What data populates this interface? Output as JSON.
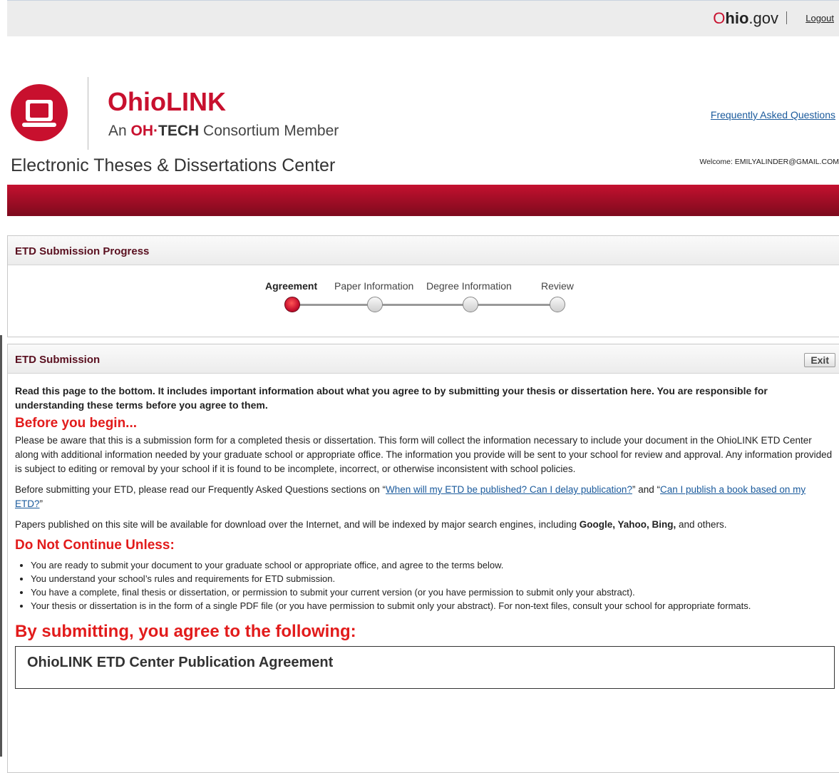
{
  "header": {
    "ohio_o": "O",
    "ohio_hio": "hio",
    "ohio_gov": ".gov",
    "logout": "Logout"
  },
  "brand": {
    "name": "OhioLINK",
    "sub_an": "An ",
    "sub_oh": "OH",
    "sub_dot": "·",
    "sub_tech": "TECH",
    "sub_rest": " Consortium Member",
    "faq": "Frequently Asked Questions",
    "center_title": "Electronic Theses & Dissertations Center",
    "welcome": "Welcome: EMILYALINDER@GMAIL.COM"
  },
  "progress": {
    "title": "ETD Submission Progress",
    "steps": [
      {
        "label": "Agreement",
        "active": true
      },
      {
        "label": "Paper Information",
        "active": false
      },
      {
        "label": "Degree Information",
        "active": false
      },
      {
        "label": "Review",
        "active": false
      }
    ]
  },
  "submission": {
    "title": "ETD Submission",
    "exit": "Exit",
    "intro": "Read this page to the bottom. It includes important information about what you agree to by submitting your thesis or dissertation here. You are responsible for understanding these terms before you agree to them.",
    "before_heading": "Before you begin...",
    "before_p1": "Please be aware that this is a submission form for a completed thesis or dissertation. This form will collect the information necessary to include your document in the OhioLINK ETD Center along with additional information needed by your graduate school or appropriate office. The information you provide will be sent to your school for review and approval. Any information provided is subject to editing or removal by your school if it is found to be incomplete, incorrect, or otherwise inconsistent with school policies.",
    "before_p2_pre": "Before submitting your ETD, please read our Frequently Asked Questions sections on “",
    "before_p2_link1": "When will my ETD be published? Can I delay publication?",
    "before_p2_mid": "” and “",
    "before_p2_link2": "Can I publish a book based on my ETD?",
    "before_p2_post": "”",
    "before_p3_pre": "Papers published on this site will be available for download over the Internet, and will be indexed by major search engines, including ",
    "before_p3_bold": "Google, Yahoo, Bing,",
    "before_p3_post": " and others.",
    "dnc_heading": "Do Not Continue Unless:",
    "rules": [
      "You are ready to submit your document to your graduate school or appropriate office, and agree to the terms below.",
      "You understand your school’s rules and requirements for ETD submission.",
      "You have a complete, final thesis or dissertation, or permission to submit your current version (or you have permission to submit only your abstract).",
      "Your thesis or dissertation is in the form of a single PDF file (or you have permission to submit only your abstract). For non-text files, consult your school for appropriate formats."
    ],
    "agree_heading": "By submitting, you agree to the following:",
    "agreement_title": "OhioLINK ETD Center Publication Agreement"
  }
}
